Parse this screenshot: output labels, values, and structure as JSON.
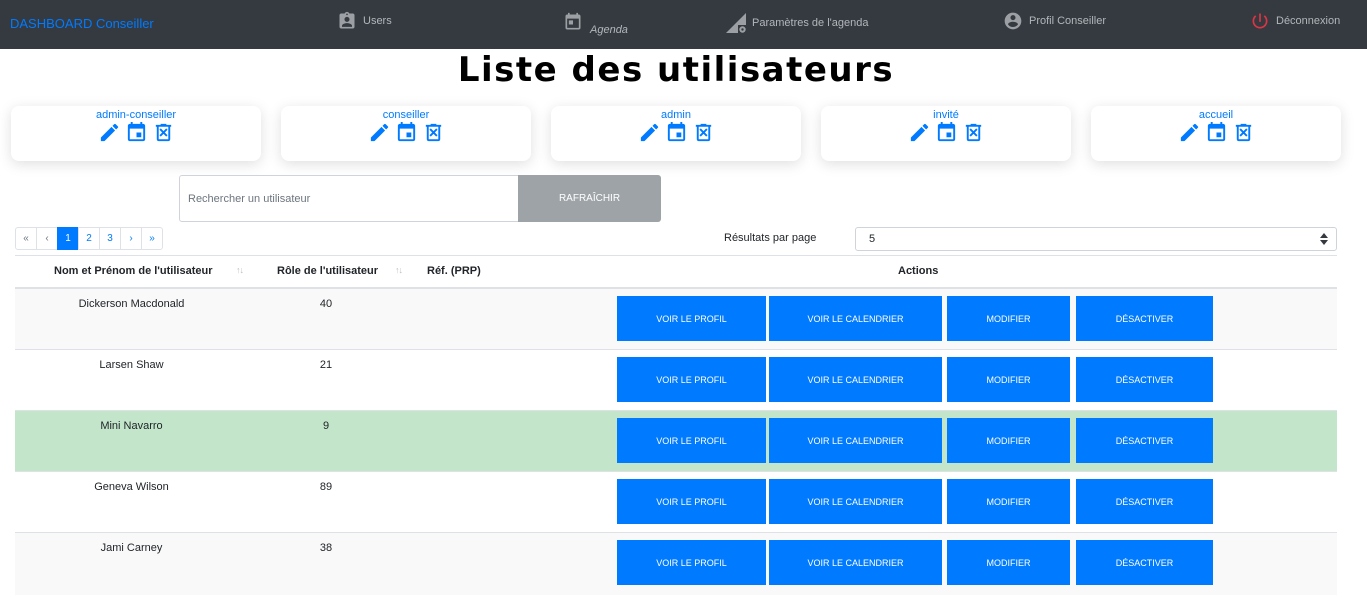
{
  "navbar": {
    "brand": "DASHBOARD Conseiller",
    "items": [
      {
        "label": "Users",
        "icon": "contact-card-icon"
      },
      {
        "label": "Agenda",
        "icon": "calendar-icon"
      },
      {
        "label": "Paramètres de l'agenda",
        "icon": "calendar-settings-icon"
      },
      {
        "label": "Profil Conseiller",
        "icon": "account-circle-icon"
      },
      {
        "label": "Déconnexion",
        "icon": "power-icon"
      }
    ]
  },
  "page": {
    "title": "Liste des utilisateurs"
  },
  "roles": [
    {
      "name": "admin-conseiller"
    },
    {
      "name": "conseiller"
    },
    {
      "name": "admin"
    },
    {
      "name": "invité"
    },
    {
      "name": "accueil"
    }
  ],
  "search": {
    "placeholder": "Rechercher un utilisateur",
    "value": "",
    "refresh_label": "RAFRAÎCHIR"
  },
  "pagination": {
    "first": "«",
    "prev": "‹",
    "pages": [
      "1",
      "2",
      "3"
    ],
    "current": "1",
    "next": "›",
    "last": "»"
  },
  "results_per_page": {
    "label": "Résultats par page",
    "value": "5"
  },
  "table": {
    "headers": {
      "name": "Nom et Prénom de l'utilisateur",
      "role": "Rôle de l'utilisateur",
      "ref": "Réf. (PRP)",
      "actions": "Actions"
    },
    "action_labels": {
      "profile": "VOIR LE PROFIL",
      "calendar": "VOIR LE CALENDRIER",
      "edit": "MODIFIER",
      "disable": "DÉSACTIVER"
    },
    "rows": [
      {
        "name": "Dickerson Macdonald",
        "role": "40",
        "ref": ""
      },
      {
        "name": "Larsen Shaw",
        "role": "21",
        "ref": ""
      },
      {
        "name": "Mini Navarro",
        "role": "9",
        "ref": "",
        "highlighted": true
      },
      {
        "name": "Geneva Wilson",
        "role": "89",
        "ref": ""
      },
      {
        "name": "Jami Carney",
        "role": "38",
        "ref": ""
      }
    ]
  },
  "colors": {
    "navbar": "#343a40",
    "primary": "#007bff",
    "highlight_row": "#c3e6cb",
    "refresh_button": "#9ea3a8",
    "logout": "#dc3545"
  }
}
